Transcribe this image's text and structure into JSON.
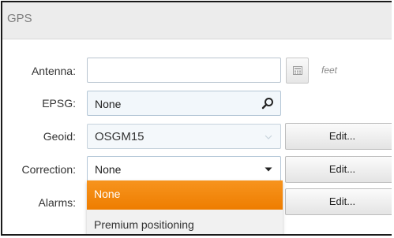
{
  "header": {
    "title": "GPS"
  },
  "form": {
    "antenna": {
      "label": "Antenna:",
      "value": "",
      "unit": "feet",
      "calculator_icon": "calculator-icon"
    },
    "epsg": {
      "label": "EPSG:",
      "value": "None",
      "icon": "search-icon"
    },
    "geoid": {
      "label": "Geoid:",
      "value": "OSGM15",
      "edit_label": "Edit..."
    },
    "correction": {
      "label": "Correction:",
      "value": "None",
      "edit_label": "Edit..."
    },
    "alarms": {
      "label": "Alarms:",
      "edit_label": "Edit..."
    }
  },
  "correction_dropdown": {
    "options": [
      "None",
      "Premium positioning"
    ],
    "selected": "None"
  },
  "colors": {
    "accent": "#f28a10",
    "header_bg": "#ececec",
    "field_border": "#b9c5d0"
  }
}
